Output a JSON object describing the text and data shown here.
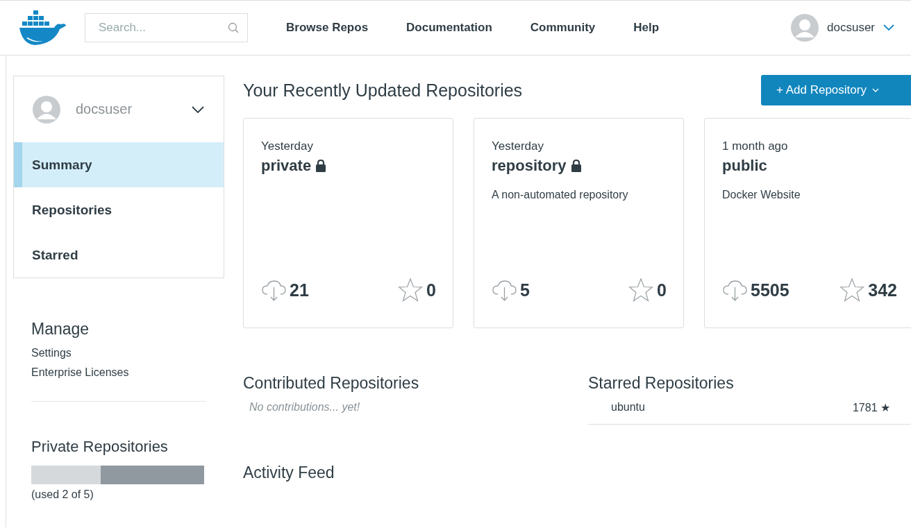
{
  "header": {
    "search": {
      "placeholder": "Search..."
    },
    "nav": [
      "Browse Repos",
      "Documentation",
      "Community",
      "Help"
    ],
    "user": {
      "name": "docsuser"
    }
  },
  "sidebar": {
    "user": {
      "name": "docsuser"
    },
    "items": [
      {
        "label": "Summary",
        "selected": true
      },
      {
        "label": "Repositories",
        "selected": false
      },
      {
        "label": "Starred",
        "selected": false
      }
    ],
    "manage": {
      "title": "Manage",
      "links": [
        "Settings",
        "Enterprise Licenses"
      ]
    },
    "private_repositories": {
      "title": "Private Repositories",
      "level": 0.4,
      "usage": "(used 2 of 5)"
    }
  },
  "main": {
    "title": "Your Recently Updated Repositories",
    "add_button": "+ Add Repository",
    "cards": [
      {
        "updated": "Yesterday",
        "name": "private",
        "private": true,
        "pulls": "21",
        "star_count": "0"
      },
      {
        "updated": "Yesterday",
        "name": "repository",
        "private": true,
        "description": "A non-automated repository",
        "pulls": "5",
        "star_count": "0"
      },
      {
        "updated": "1 month ago",
        "name": "public",
        "private": false,
        "description": "Docker Website",
        "pulls": "5505",
        "star_count": "342"
      }
    ],
    "contributed": {
      "title": "Contributed Repositories",
      "empty_text": "No contributions... yet!"
    },
    "starred": {
      "title": "Starred Repositories",
      "rows": [
        {
          "name": "ubuntu",
          "count": "1781 ★"
        }
      ]
    },
    "activity": {
      "title": "Activity Feed"
    }
  }
}
